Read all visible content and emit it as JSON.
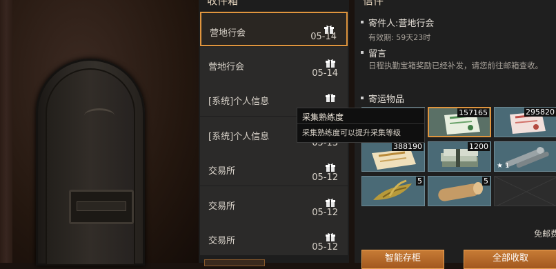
{
  "inbox": {
    "title": "收件箱",
    "items": [
      {
        "sender": "营地行会",
        "date": "05-14",
        "icon": "gift-icon",
        "selected": true
      },
      {
        "sender": "营地行会",
        "date": "05-14",
        "icon": "gift-icon",
        "selected": false
      },
      {
        "sender": "[系统]个人信息",
        "date": "",
        "icon": "gift-icon",
        "selected": false
      },
      {
        "sender": "[系统]个人信息",
        "date": "05-13",
        "icon": "gift-icon",
        "selected": false
      },
      {
        "sender": "交易所",
        "date": "05-12",
        "icon": "gift-icon",
        "selected": false
      },
      {
        "sender": "交易所",
        "date": "05-12",
        "icon": "gift-icon",
        "selected": false
      },
      {
        "sender": "交易所",
        "date": "05-12",
        "icon": "gift-icon",
        "selected": false
      }
    ]
  },
  "letter": {
    "title": "信件",
    "sender_line": "寄件人:营地行会",
    "validity": "有效期: 59天23时",
    "message_heading": "留言",
    "message": "日程执勤宝箱奖励已经补发，请您前往邮箱查收。",
    "attachments_heading": "寄运物品",
    "attachments": [
      {
        "name": "green-ticket-icon",
        "count": "",
        "selected": false
      },
      {
        "name": "green-scroll-icon",
        "count": "157165",
        "selected": true
      },
      {
        "name": "red-scroll-icon",
        "count": "295820",
        "selected": false
      },
      {
        "name": "gold-scroll-icon",
        "count": "388190",
        "selected": false
      },
      {
        "name": "cash-stack-icon",
        "count": "1200",
        "selected": false
      },
      {
        "name": "pipe-icon",
        "count": "",
        "star": "★ 1",
        "selected": false
      },
      {
        "name": "leaf-icon",
        "count": "5",
        "selected": false
      },
      {
        "name": "wood-log-icon",
        "count": "5",
        "selected": false
      }
    ],
    "postage": "免邮费",
    "buttons": {
      "store": "智能存柜",
      "collect_all": "全部收取"
    }
  },
  "tooltip": {
    "title": "采集熟练度",
    "description": "采集熟练度可以提升采集等级"
  },
  "colors": {
    "accent": "#e0953e",
    "button": "#b86a2a"
  }
}
